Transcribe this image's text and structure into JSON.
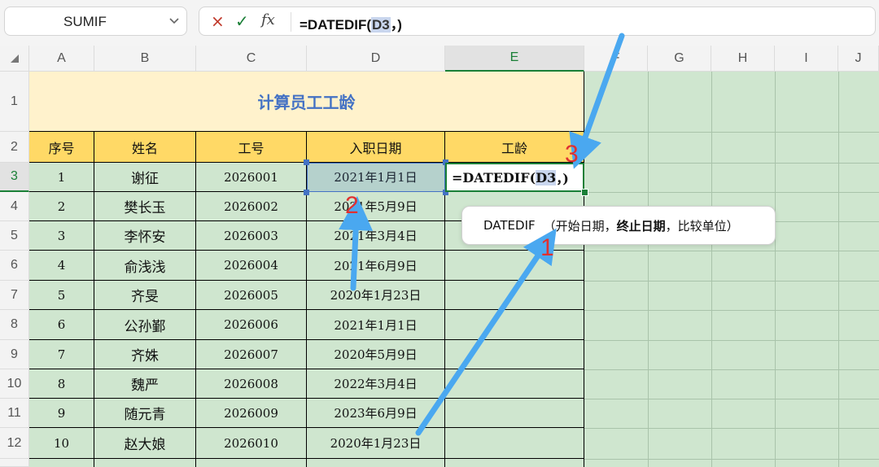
{
  "name_box": {
    "value": "SUMIF"
  },
  "formula_bar": {
    "cancel_icon": "×",
    "enter_icon": "✓",
    "fx_icon": "fx",
    "formula_prefix": "=DATEDIF(",
    "formula_ref": "D3",
    "formula_suffix": "，)"
  },
  "columns": [
    "A",
    "B",
    "C",
    "D",
    "E",
    "F",
    "G",
    "H",
    "I",
    "J"
  ],
  "rows": [
    "1",
    "2",
    "3",
    "4",
    "5",
    "6",
    "7",
    "8",
    "9",
    "10",
    "11",
    "12"
  ],
  "sheet": {
    "title": "计算员工工龄",
    "headers": [
      "序号",
      "姓名",
      "工号",
      "入职日期",
      "工龄"
    ],
    "data": [
      [
        "1",
        "谢征",
        "2026001",
        "2021年1月1日",
        ""
      ],
      [
        "2",
        "樊长玉",
        "2026002",
        "2021年5月9日",
        ""
      ],
      [
        "3",
        "李怀安",
        "2026003",
        "2021年3月4日",
        ""
      ],
      [
        "4",
        "俞浅浅",
        "2026004",
        "2021年6月9日",
        ""
      ],
      [
        "5",
        "齐旻",
        "2026005",
        "2020年1月23日",
        ""
      ],
      [
        "6",
        "公孙鄞",
        "2026006",
        "2021年1月1日",
        ""
      ],
      [
        "7",
        "齐姝",
        "2026007",
        "2020年5月9日",
        ""
      ],
      [
        "8",
        "魏严",
        "2026008",
        "2022年3月4日",
        ""
      ],
      [
        "9",
        "随元青",
        "2026009",
        "2023年6月9日",
        ""
      ],
      [
        "10",
        "赵大娘",
        "2026010",
        "2020年1月23日",
        ""
      ]
    ]
  },
  "cell_edit": {
    "prefix": "=DATEDIF(",
    "ref": "D3",
    "suffix": "，)"
  },
  "tooltip": {
    "fn": "DATEDIF",
    "open": "（开始日期，",
    "bold_arg": "终止日期",
    "close": "，比较单位）"
  },
  "annotations": [
    "1",
    "2",
    "3"
  ],
  "colors": {
    "title_bg": "#fff2cc",
    "title_text": "#4472c4",
    "header_bg": "#ffd966",
    "body_bg": "#cfe6cf",
    "arrow": "#4aa8f0",
    "annotation_number": "#e03030",
    "active_green": "#1a7f37"
  }
}
